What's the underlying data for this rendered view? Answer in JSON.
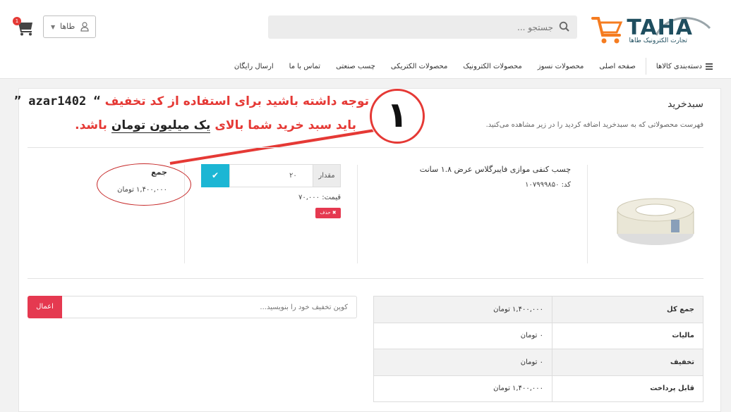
{
  "header": {
    "logo_text": "TAHA",
    "logo_subtitle": "تجارت الکترونیک طاها",
    "search_placeholder": "جستجو ...",
    "user_label": "طاها",
    "cart_badge": "1"
  },
  "nav": {
    "categories_label": "دسته‌بندی کالاها",
    "items": [
      "صفحه اصلی",
      "محصولات نسوز",
      "محصولات الکترونیک",
      "محصولات الکتریکی",
      "چسب صنعتی",
      "تماس با ما",
      "ارسال رایگان"
    ]
  },
  "cart": {
    "title": "سبدخرید",
    "subtitle": "فهرست محصولاتی که به سبدخرید اضافه کردید را در زیر مشاهده می‌کنید."
  },
  "notice": {
    "line1_text": "توجه داشته باشید برای استفاده از کد تخفیف",
    "coupon_code": "“ azar1402 ”",
    "line2_prefix": "باید سبد خرید شما بالای",
    "line2_highlight": "یک میلیون تومان",
    "line2_suffix": "باشد.",
    "annotation_number": "۱"
  },
  "product": {
    "name": "چسب کنفی موازی فایبرگلاس عرض ۱.۸ سانت",
    "code_label": "کد: ۱۰۷۹۹۹۸۵۰",
    "quantity_label": "مقدار",
    "quantity_value": "۲۰",
    "price_label": "قیمت: ۷۰,۰۰۰",
    "delete_label": "✖ حذف",
    "sum_label": "جمع",
    "sum_value": "۱,۴۰۰,۰۰۰ تومان"
  },
  "coupon": {
    "placeholder": "کوپن تخفیف خود را بنویسید...",
    "apply_label": "اعمال"
  },
  "totals": [
    {
      "label": "جمع کل",
      "value": "۱,۴۰۰,۰۰۰ تومان"
    },
    {
      "label": "مالیات",
      "value": "۰ تومان"
    },
    {
      "label": "تخفیف",
      "value": "۰ تومان"
    },
    {
      "label": "قابل پرداخت",
      "value": "۱,۴۰۰,۰۰۰ تومان"
    }
  ],
  "colors": {
    "accent_red": "#e53935",
    "confirm_cyan": "#1cb6d4",
    "logo_blue": "#1f4e5f",
    "logo_orange": "#f57c20"
  }
}
